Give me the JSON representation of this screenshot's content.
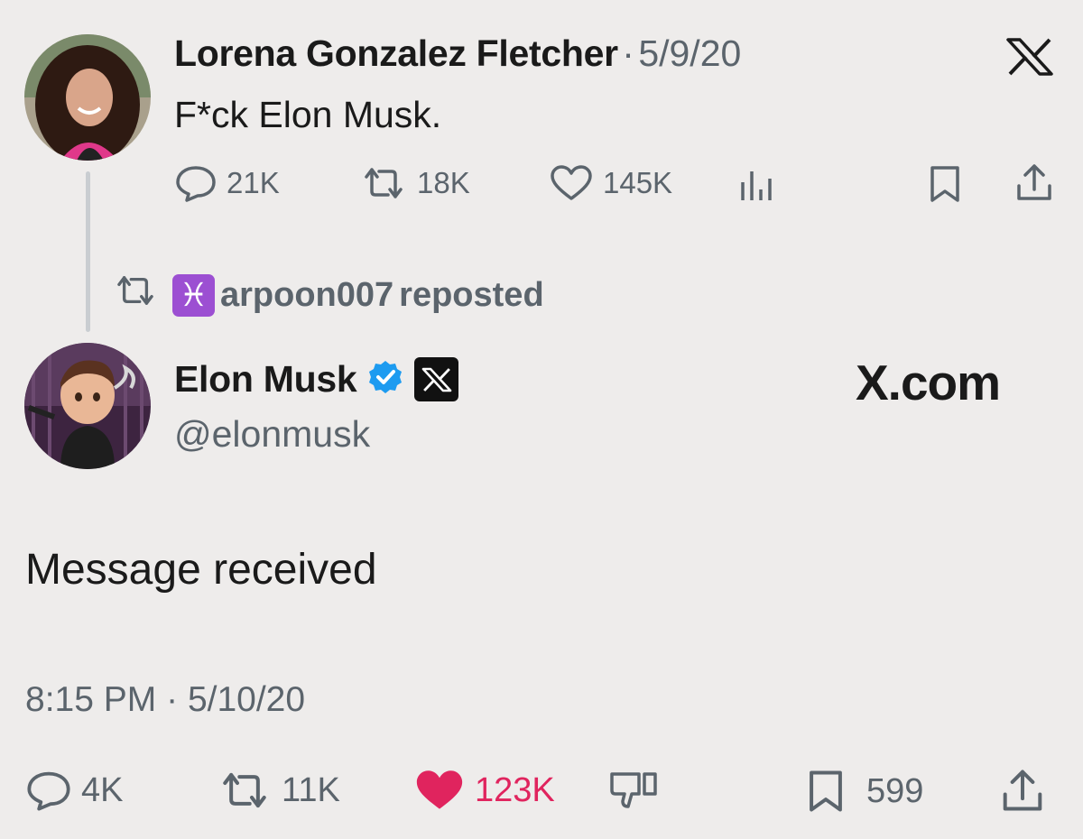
{
  "top_tweet": {
    "author": "Lorena Gonzalez Fletcher",
    "separator": "·",
    "date": "5/9/20",
    "text": "F*ck Elon Musk.",
    "replies": "21K",
    "reposts": "18K",
    "likes": "145K",
    "icons": [
      "x-logo-icon",
      "reply-icon",
      "repost-icon",
      "like-icon",
      "views-icon",
      "bookmark-icon",
      "share-icon"
    ]
  },
  "repost_banner": {
    "badge": "♓",
    "username": "arpoon007",
    "suffix": "reposted"
  },
  "main_tweet": {
    "author": "Elon Musk",
    "handle": "@elonmusk",
    "site_label": "X.com",
    "message": "Message received",
    "time": "8:15 PM",
    "separator": "·",
    "date": "5/10/20",
    "replies": "4K",
    "reposts": "11K",
    "likes": "123K",
    "bookmarks": "599",
    "icons": [
      "verified-icon",
      "x-badge-icon",
      "reply-icon",
      "repost-icon",
      "liked-heart-icon",
      "dislike-icon",
      "bookmark-icon",
      "share-icon"
    ]
  },
  "colors": {
    "background": "#eeeceb",
    "muted_text": "#5b646c",
    "like_pink": "#e0245e",
    "verified_blue": "#1d9bf0",
    "pisces_purple": "#9c4fd2"
  }
}
